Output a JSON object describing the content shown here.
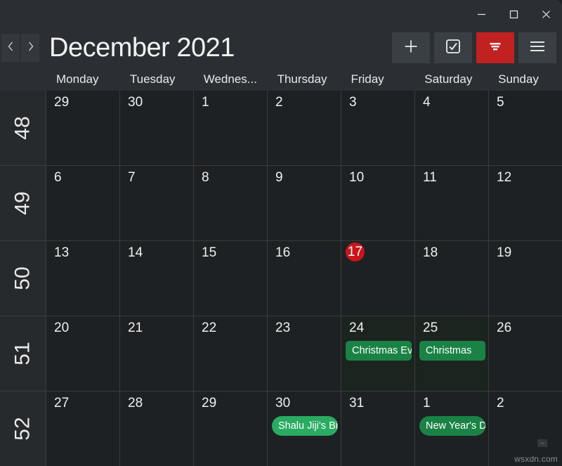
{
  "window": {
    "controls": [
      {
        "name": "minimize",
        "glyph": "minimize-icon"
      },
      {
        "name": "maximize",
        "glyph": "maximize-icon"
      },
      {
        "name": "close",
        "glyph": "close-icon"
      }
    ]
  },
  "header": {
    "prev_label": "‹",
    "next_label": "›",
    "month_title": "December 2021",
    "tools": [
      {
        "name": "add-event",
        "icon": "plus-icon",
        "accent": false
      },
      {
        "name": "tasks",
        "icon": "checkbox-icon",
        "accent": false
      },
      {
        "name": "filter",
        "icon": "filter-icon",
        "accent": true
      },
      {
        "name": "menu",
        "icon": "hamburger-icon",
        "accent": false
      }
    ],
    "accent_color": "#c22121"
  },
  "weekdays": [
    "Monday",
    "Tuesday",
    "Wednes...",
    "Thursday",
    "Friday",
    "Saturday",
    "Sunday"
  ],
  "week_numbers": [
    "48",
    "49",
    "50",
    "51",
    "52"
  ],
  "today": "17",
  "today_color": "#c9151b",
  "event_colors": {
    "dark_green": "#1a8245",
    "light_green": "#2aab62"
  },
  "weeks": [
    {
      "number": "48",
      "days": [
        {
          "num": "29",
          "tinted": false,
          "events": []
        },
        {
          "num": "30",
          "tinted": false,
          "events": []
        },
        {
          "num": "1",
          "tinted": false,
          "events": []
        },
        {
          "num": "2",
          "tinted": false,
          "events": []
        },
        {
          "num": "3",
          "tinted": false,
          "events": []
        },
        {
          "num": "4",
          "tinted": false,
          "events": []
        },
        {
          "num": "5",
          "tinted": false,
          "events": []
        }
      ]
    },
    {
      "number": "49",
      "days": [
        {
          "num": "6",
          "tinted": false,
          "events": []
        },
        {
          "num": "7",
          "tinted": false,
          "events": []
        },
        {
          "num": "8",
          "tinted": false,
          "events": []
        },
        {
          "num": "9",
          "tinted": false,
          "events": []
        },
        {
          "num": "10",
          "tinted": false,
          "events": []
        },
        {
          "num": "11",
          "tinted": false,
          "events": []
        },
        {
          "num": "12",
          "tinted": false,
          "events": []
        }
      ]
    },
    {
      "number": "50",
      "days": [
        {
          "num": "13",
          "tinted": false,
          "events": []
        },
        {
          "num": "14",
          "tinted": false,
          "events": []
        },
        {
          "num": "15",
          "tinted": false,
          "events": []
        },
        {
          "num": "16",
          "tinted": false,
          "events": []
        },
        {
          "num": "17",
          "tinted": false,
          "today": true,
          "events": []
        },
        {
          "num": "18",
          "tinted": false,
          "events": []
        },
        {
          "num": "19",
          "tinted": false,
          "events": []
        }
      ]
    },
    {
      "number": "51",
      "days": [
        {
          "num": "20",
          "tinted": false,
          "events": []
        },
        {
          "num": "21",
          "tinted": false,
          "events": []
        },
        {
          "num": "22",
          "tinted": false,
          "events": []
        },
        {
          "num": "23",
          "tinted": false,
          "events": []
        },
        {
          "num": "24",
          "tinted": true,
          "events": [
            {
              "label": "Christmas Ev",
              "color": "#1a8245",
              "round": false
            }
          ]
        },
        {
          "num": "25",
          "tinted": true,
          "events": [
            {
              "label": "Christmas",
              "color": "#1a8245",
              "round": false
            }
          ]
        },
        {
          "num": "26",
          "tinted": false,
          "events": []
        }
      ]
    },
    {
      "number": "52",
      "days": [
        {
          "num": "27",
          "tinted": false,
          "events": []
        },
        {
          "num": "28",
          "tinted": false,
          "events": []
        },
        {
          "num": "29",
          "tinted": false,
          "events": []
        },
        {
          "num": "30",
          "tinted": false,
          "events": [
            {
              "label": "Shalu Jiji's Bi",
              "color": "#2aab62",
              "round": true
            }
          ]
        },
        {
          "num": "31",
          "tinted": false,
          "events": []
        },
        {
          "num": "1",
          "tinted": false,
          "events": [
            {
              "label": "New Year's D",
              "color": "#1a8245",
              "round": true
            }
          ]
        },
        {
          "num": "2",
          "tinted": false,
          "events": []
        }
      ]
    }
  ],
  "footer": {
    "watermark": "wsxdn.com",
    "resize_grip": "–"
  }
}
